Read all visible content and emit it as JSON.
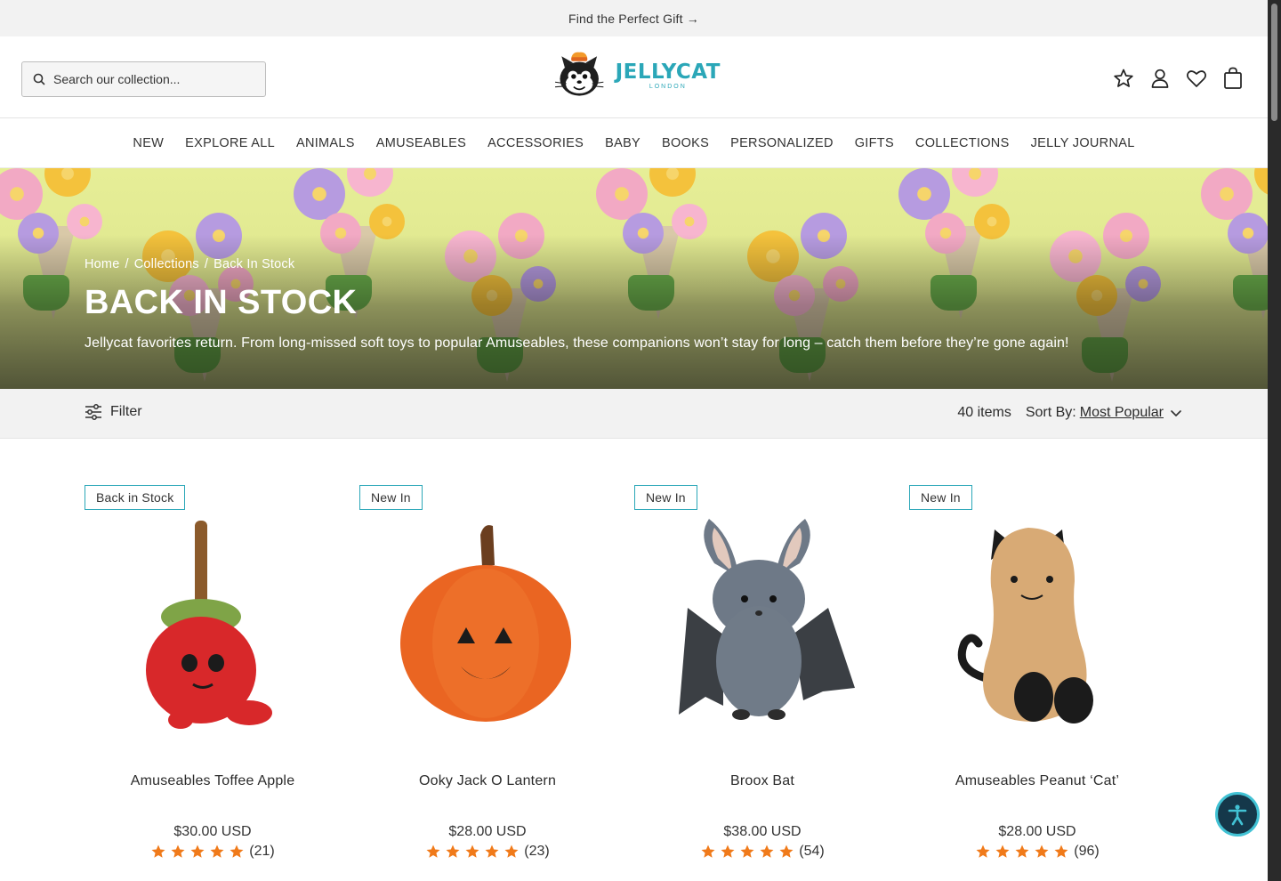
{
  "announcement": {
    "text": "Find the Perfect Gift →"
  },
  "header": {
    "search_placeholder": "Search our collection...",
    "logo_word": "JELLYCAT",
    "logo_sub": "LONDON"
  },
  "nav": {
    "items": [
      "NEW",
      "EXPLORE ALL",
      "ANIMALS",
      "AMUSEABLES",
      "ACCESSORIES",
      "BABY",
      "BOOKS",
      "PERSONALIZED",
      "GIFTS",
      "COLLECTIONS",
      "JELLY JOURNAL"
    ]
  },
  "hero": {
    "breadcrumbs": [
      "Home",
      "/",
      "Collections",
      "/",
      "Back In Stock"
    ],
    "title": "BACK IN STOCK",
    "description": "Jellycat favorites return. From long-missed soft toys to popular Amuseables, these companions won’t stay for long – catch them before they’re gone again!"
  },
  "filterbar": {
    "filter_label": "Filter",
    "item_count": "40 items",
    "sort_label": "Sort By:",
    "sort_value": "Most Popular"
  },
  "products": [
    {
      "badge": "Back in Stock",
      "name": "Amuseables Toffee Apple",
      "price": "$30.00 USD",
      "rating": 5,
      "reviews": "(21)"
    },
    {
      "badge": "New In",
      "name": "Ooky Jack O Lantern",
      "price": "$28.00 USD",
      "rating": 5,
      "reviews": "(23)"
    },
    {
      "badge": "New In",
      "name": "Broox Bat",
      "price": "$38.00 USD",
      "rating": 5,
      "reviews": "(54)"
    },
    {
      "badge": "New In",
      "name": "Amuseables Peanut ‘Cat’",
      "price": "$28.00 USD",
      "rating": 5,
      "reviews": "(96)"
    }
  ],
  "colors": {
    "brand_teal": "#2ba7b8",
    "star_orange": "#f07a1a",
    "hero_bg": "#e3ec92",
    "a11y_bg": "#15384a"
  },
  "icons": [
    "search-icon",
    "star-icon",
    "account-icon",
    "wishlist-heart-icon",
    "bag-icon",
    "filter-sliders-icon",
    "chevron-down-icon",
    "accessibility-icon"
  ]
}
